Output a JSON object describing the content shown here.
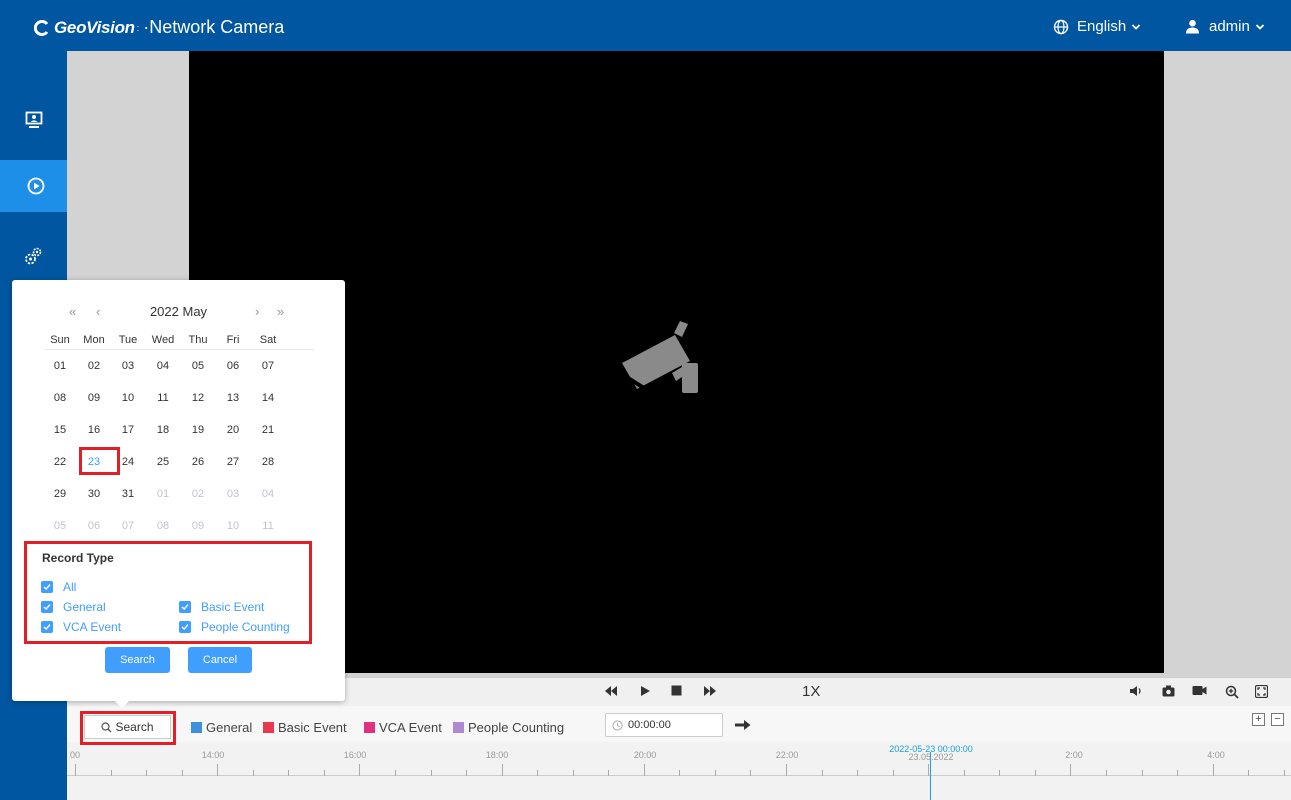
{
  "header": {
    "brand": "GeoVision",
    "product": "·Network Camera",
    "language": "English",
    "user": "admin"
  },
  "sidebar": {
    "items": [
      {
        "name": "live-view",
        "icon": "monitor-icon"
      },
      {
        "name": "playback",
        "icon": "play-circle-icon",
        "active": true
      },
      {
        "name": "settings",
        "icon": "gears-icon"
      }
    ]
  },
  "player": {
    "speed": "1X",
    "placeholder_icon": "camera-off-icon"
  },
  "legend": {
    "search_label": "Search",
    "items": [
      {
        "label": "General",
        "color": "#3d8fe0"
      },
      {
        "label": "Basic Event",
        "color": "#e8394f"
      },
      {
        "label": "VCA Event",
        "color": "#e0317e"
      },
      {
        "label": "People Counting",
        "color": "#b188d2"
      }
    ],
    "time_value": "00:00:00"
  },
  "timeline": {
    "labels": [
      "00",
      "14:00",
      "16:00",
      "18:00",
      "20:00",
      "22:00",
      "2:00",
      "4:00"
    ],
    "cursor_datetime": "2022-05-23 00:00:00",
    "cursor_date": "23.05.2022"
  },
  "calendar": {
    "title": "2022 May",
    "weekdays": [
      "Sun",
      "Mon",
      "Tue",
      "Wed",
      "Thu",
      "Fri",
      "Sat"
    ],
    "weeks": [
      [
        "01",
        "02",
        "03",
        "04",
        "05",
        "06",
        "07"
      ],
      [
        "08",
        "09",
        "10",
        "11",
        "12",
        "13",
        "14"
      ],
      [
        "15",
        "16",
        "17",
        "18",
        "19",
        "20",
        "21"
      ],
      [
        "22",
        "23",
        "24",
        "25",
        "26",
        "27",
        "28"
      ],
      [
        "29",
        "30",
        "31",
        "01",
        "02",
        "03",
        "04"
      ],
      [
        "05",
        "06",
        "07",
        "08",
        "09",
        "10",
        "11"
      ]
    ],
    "selected_day": "23"
  },
  "record_type": {
    "title": "Record Type",
    "options": {
      "all": "All",
      "general": "General",
      "basic_event": "Basic Event",
      "vca_event": "VCA Event",
      "people_counting": "People Counting"
    }
  },
  "popup_buttons": {
    "search": "Search",
    "cancel": "Cancel"
  }
}
